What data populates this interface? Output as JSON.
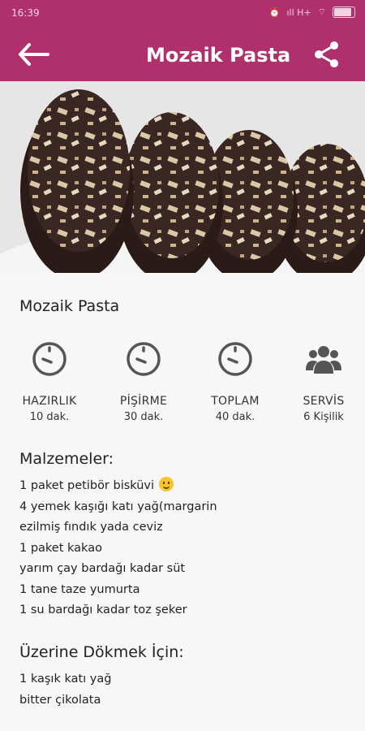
{
  "status_bar": {
    "time": "16:39",
    "network": "ıll H+"
  },
  "app_bar": {
    "title": "Mozaik Pasta",
    "back_icon": "arrow-back-icon",
    "share_icon": "share-icon"
  },
  "recipe": {
    "name": "Mozaik Pasta",
    "stats": [
      {
        "label": "HAZIRLIK",
        "value": "10 dak.",
        "icon": "timer-icon"
      },
      {
        "label": "PİŞİRME",
        "value": "30 dak.",
        "icon": "timer-icon"
      },
      {
        "label": "TOPLAM",
        "value": "40 dak.",
        "icon": "timer-icon"
      },
      {
        "label": "SERVİS",
        "value": "6 Kişilik",
        "icon": "people-icon"
      }
    ],
    "ingredients_title": "Malzemeler:",
    "ingredients": [
      "1 paket petibör bisküvi",
      "4 yemek kaşığı katı yağ(margarin",
      "ezilmiş fındık yada ceviz",
      "1 paket kakao",
      "yarım çay bardağı kadar süt",
      "1 tane taze yumurta",
      "1 su bardağı kadar toz şeker"
    ],
    "topping_title": "Üzerine Dökmek İçin:",
    "topping": [
      "1 kaşık katı yağ",
      "bitter çikolata"
    ]
  },
  "colors": {
    "primary": "#b0306e",
    "background": "#f7f7f7",
    "icon_gray": "#555555"
  }
}
